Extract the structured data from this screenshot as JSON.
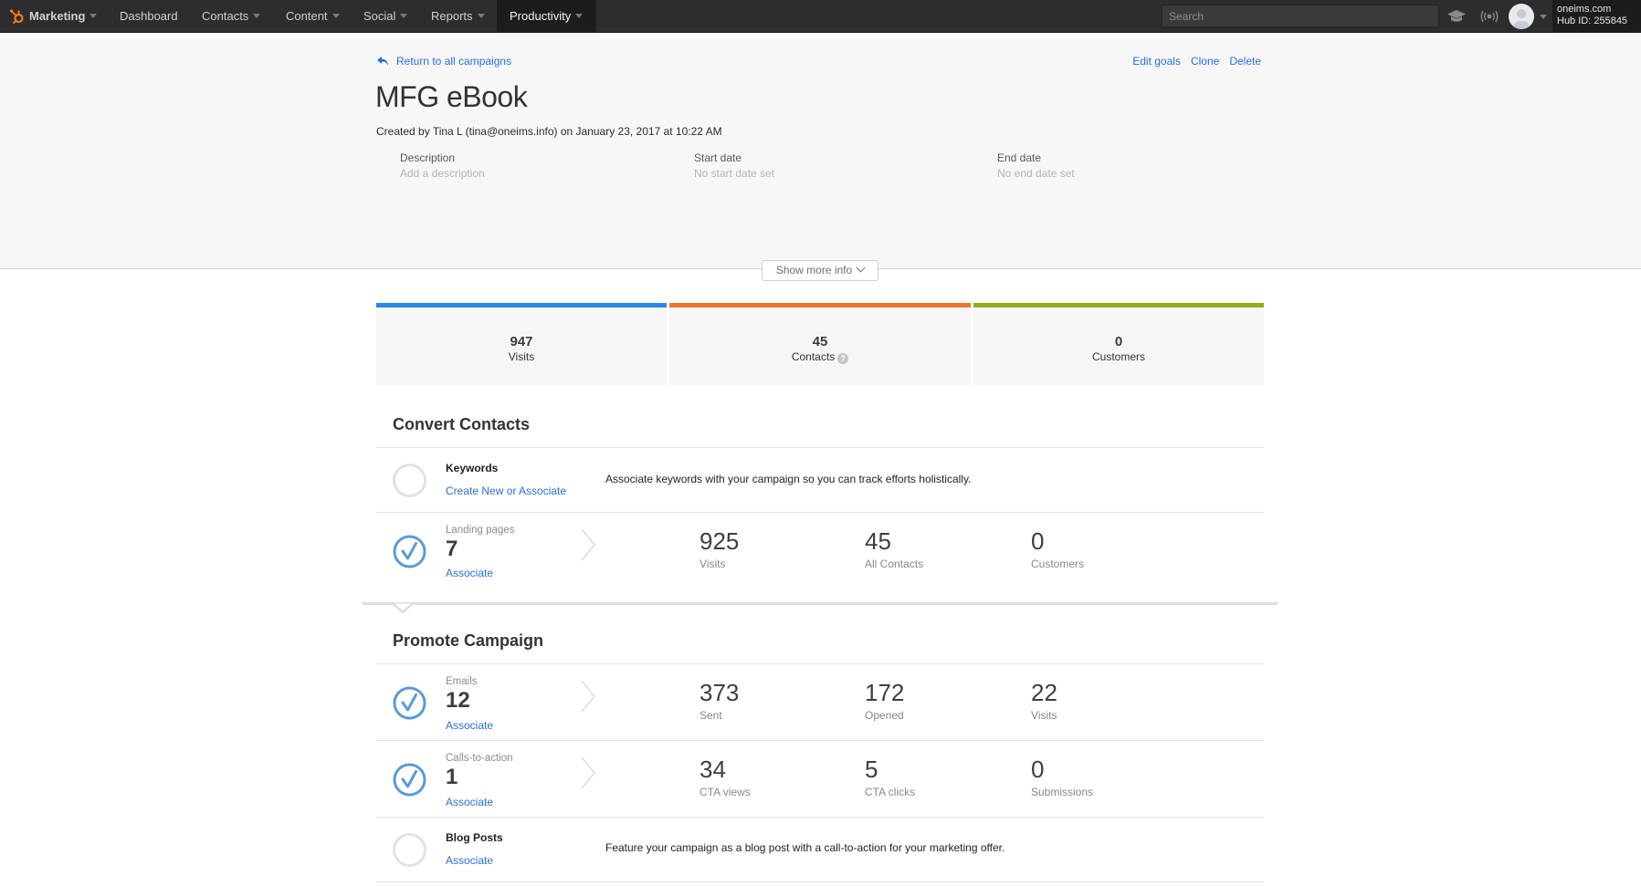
{
  "nav": {
    "brand": "Marketing",
    "items": [
      {
        "label": "Dashboard",
        "dropdown": false
      },
      {
        "label": "Contacts",
        "dropdown": true
      },
      {
        "label": "Content",
        "dropdown": true
      },
      {
        "label": "Social",
        "dropdown": true
      },
      {
        "label": "Reports",
        "dropdown": true
      },
      {
        "label": "Productivity",
        "dropdown": true,
        "active": true
      }
    ],
    "search_placeholder": "Search",
    "account_domain": "oneims.com",
    "hub_id": "Hub ID: 255845"
  },
  "header": {
    "back_link": "Return to all campaigns",
    "actions": {
      "edit_goals": "Edit goals",
      "clone": "Clone",
      "delete": "Delete"
    },
    "title": "MFG eBook",
    "created_by": "Created by Tina L (tina@oneims.info) on January 23, 2017 at 10:22 AM",
    "description_label": "Description",
    "description_value": "Add a description",
    "start_label": "Start date",
    "start_value": "No start date set",
    "end_label": "End date",
    "end_value": "No end date set",
    "show_more": "Show more info"
  },
  "stats": [
    {
      "value": "947",
      "label": "Visits",
      "color": "#2d87e2"
    },
    {
      "value": "45",
      "label": "Contacts",
      "color": "#ec7530",
      "help": "?"
    },
    {
      "value": "0",
      "label": "Customers",
      "color": "#9bab1b"
    }
  ],
  "convert": {
    "title": "Convert Contacts",
    "keywords": {
      "title": "Keywords",
      "link": "Create New or Associate",
      "description": "Associate keywords with your campaign so you can track efforts holistically."
    },
    "landing_pages": {
      "label": "Landing pages",
      "count": "7",
      "link": "Associate",
      "metrics": [
        {
          "value": "925",
          "label": "Visits"
        },
        {
          "value": "45",
          "label": "All Contacts"
        },
        {
          "value": "0",
          "label": "Customers"
        }
      ]
    }
  },
  "promote": {
    "title": "Promote Campaign",
    "emails": {
      "label": "Emails",
      "count": "12",
      "link": "Associate",
      "metrics": [
        {
          "value": "373",
          "label": "Sent"
        },
        {
          "value": "172",
          "label": "Opened"
        },
        {
          "value": "22",
          "label": "Visits"
        }
      ]
    },
    "ctas": {
      "label": "Calls-to-action",
      "count": "1",
      "link": "Associate",
      "metrics": [
        {
          "value": "34",
          "label": "CTA views"
        },
        {
          "value": "5",
          "label": "CTA clicks"
        },
        {
          "value": "0",
          "label": "Submissions"
        }
      ]
    },
    "blog_posts": {
      "title": "Blog Posts",
      "link": "Associate",
      "description": "Feature your campaign as a blog post with a call-to-action for your marketing offer."
    }
  },
  "colors": {
    "accent_link": "#2a6fd6",
    "check_blue": "#5a9bd5",
    "visits_bar": "#2d87e2",
    "contacts_bar": "#ec7530",
    "customers_bar": "#9bab1b"
  }
}
